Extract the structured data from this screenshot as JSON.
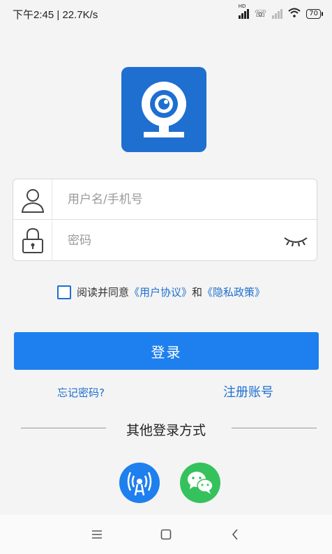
{
  "status_bar": {
    "time": "下午2:45",
    "net_speed": "22.7K/s",
    "hd_label": "HD",
    "battery": "70"
  },
  "logo": {
    "icon": "webcam-icon",
    "color": "#1e6fd0"
  },
  "form": {
    "username_placeholder": "用户名/手机号",
    "password_placeholder": "密码",
    "username_icon": "user-icon",
    "password_icon": "lock-icon",
    "toggle_icon": "eye-closed-icon"
  },
  "agreement": {
    "prefix": "阅读并同意",
    "user_agreement": "《用户协议》",
    "connector": "和",
    "privacy_policy": "《隐私政策》"
  },
  "login_button": "登录",
  "forgot_password": "忘记密码?",
  "register": "注册账号",
  "other_login_title": "其他登录方式",
  "social": [
    {
      "icon": "signal-tower-icon",
      "color": "#1e7fee"
    },
    {
      "icon": "wechat-icon",
      "color": "#35c25c"
    }
  ],
  "colors": {
    "accent": "#1e7fee",
    "link": "#1e6fd0"
  }
}
